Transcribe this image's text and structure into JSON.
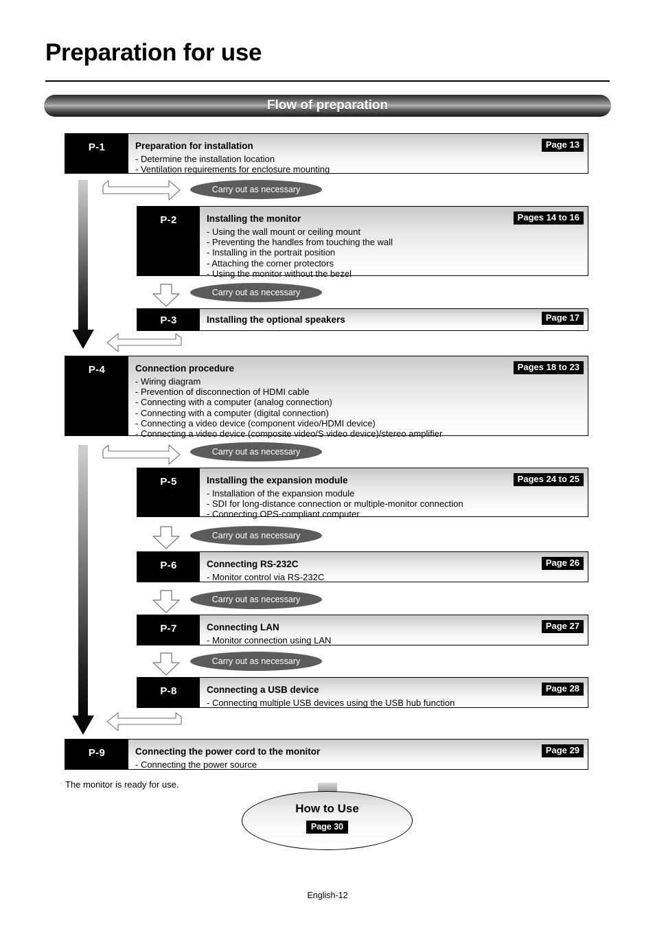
{
  "page": {
    "title": "Preparation for use",
    "banner": "Flow of preparation",
    "ready_text": "The monitor is ready for use.",
    "footer": "English-12"
  },
  "connector_label": "Carry out as necessary",
  "steps": [
    {
      "tag": "P-1",
      "heading": "Preparation for installation",
      "page": "Page 13",
      "items": [
        "- Determine the installation location",
        "- Ventilation requirements for enclosure mounting"
      ]
    },
    {
      "tag": "P-2",
      "heading": "Installing the monitor",
      "page": "Pages 14 to 16",
      "items": [
        "- Using the wall mount or ceiling mount",
        "- Preventing the handles from touching the wall",
        "- Installing in the portrait position",
        "- Attaching the corner protectors",
        "- Using the monitor without the bezel"
      ]
    },
    {
      "tag": "P-3",
      "heading": "Installing the optional speakers",
      "page": "Page 17",
      "items": []
    },
    {
      "tag": "P-4",
      "heading": "Connection procedure",
      "page": "Pages 18 to 23",
      "items": [
        "- Wiring diagram",
        "- Prevention of disconnection of HDMI cable",
        "- Connecting with a computer (analog connection)",
        "- Connecting with a computer (digital connection)",
        "- Connecting a video device (component video/HDMI device)",
        "- Connecting a video device (composite video/S video device)/stereo amplifier"
      ]
    },
    {
      "tag": "P-5",
      "heading": "Installing the expansion module",
      "page": "Pages 24 to 25",
      "items": [
        "- Installation of the expansion module",
        "- SDI for long-distance connection or multiple-monitor connection",
        "- Connecting OPS-compliant computer"
      ]
    },
    {
      "tag": "P-6",
      "heading": "Connecting RS-232C",
      "page": "Page 26",
      "items": [
        "- Monitor control via RS-232C"
      ]
    },
    {
      "tag": "P-7",
      "heading": "Connecting LAN",
      "page": "Page 27",
      "items": [
        "- Monitor connection using LAN"
      ]
    },
    {
      "tag": "P-8",
      "heading": "Connecting a USB device",
      "page": "Page 28",
      "items": [
        "- Connecting multiple USB devices using the USB hub function"
      ]
    },
    {
      "tag": "P-9",
      "heading": "Connecting the power cord to the monitor",
      "page": "Page 29",
      "items": [
        "- Connecting the power source"
      ]
    }
  ],
  "destination": {
    "label": "How to Use",
    "page": "Page 30"
  },
  "colors": {
    "tag_bg": "#000000",
    "pill_bg": "#5c5c5c",
    "badge_bg": "#000000",
    "text": "#000000"
  }
}
